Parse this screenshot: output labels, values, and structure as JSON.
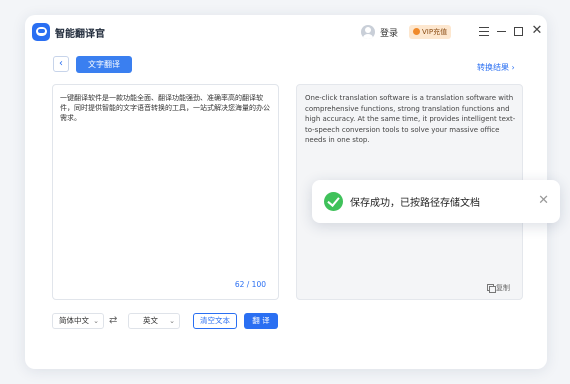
{
  "app": {
    "title": "智能翻译官"
  },
  "header": {
    "login": "登录",
    "vip": "VIP充值"
  },
  "toolbar": {
    "back": "‹",
    "mode_tab": "文字翻译",
    "swap_result": "转换结果 ›"
  },
  "source": {
    "text": "一键翻译软件是一款功能全面、翻译功能强劲、准确率高的翻译软件，同时提供智能的文字语音转换的工具，一站式解决您海量的办公需求。",
    "counter": "62 / 100"
  },
  "target": {
    "text": "One-click translation software is a translation software with comprehensive functions, strong translation functions and high accuracy. At the same time, it provides intelligent text-to-speech conversion tools to solve your massive office needs in one stop.",
    "copy": "复制"
  },
  "controls": {
    "source_lang": "简体中文",
    "target_lang": "英文",
    "swap": "⇄",
    "chevron": "⌄",
    "clear": "清空文本",
    "translate": "翻 译"
  },
  "toast": {
    "message": "保存成功，已按路径存储文档",
    "close": "✕"
  },
  "window_controls": {
    "close": "✕"
  },
  "colors": {
    "accent": "#2a6ff2",
    "success": "#3fc15a",
    "vip_bg": "#fde7cf"
  }
}
